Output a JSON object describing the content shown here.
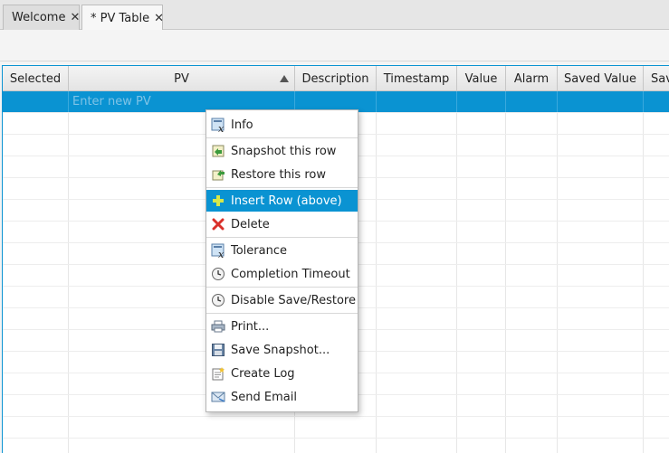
{
  "tabs": [
    {
      "label": "Welcome",
      "close": "✕"
    },
    {
      "label": "* PV Table",
      "close": "✕"
    }
  ],
  "table": {
    "columns": [
      "Selected",
      "PV",
      "Description",
      "Timestamp",
      "Value",
      "Alarm",
      "Saved Value",
      "Sav"
    ],
    "new_pv_placeholder": "Enter new PV"
  },
  "menu": {
    "items": [
      {
        "label": "Info",
        "icon": "info-x-icon"
      },
      {
        "label": "Snapshot this row",
        "icon": "snapshot-icon"
      },
      {
        "label": "Restore this row",
        "icon": "restore-icon"
      },
      {
        "label": "Insert Row (above)",
        "icon": "plus-icon"
      },
      {
        "label": "Delete",
        "icon": "delete-icon"
      },
      {
        "label": "Tolerance",
        "icon": "tolerance-icon"
      },
      {
        "label": "Completion Timeout",
        "icon": "clock-icon"
      },
      {
        "label": "Disable Save/Restore",
        "icon": "clock-icon"
      },
      {
        "label": "Print...",
        "icon": "printer-icon"
      },
      {
        "label": "Save Snapshot...",
        "icon": "floppy-icon"
      },
      {
        "label": "Create Log",
        "icon": "log-icon"
      },
      {
        "label": "Send Email",
        "icon": "email-icon"
      }
    ]
  },
  "colors": {
    "accent": "#0a93d2"
  }
}
